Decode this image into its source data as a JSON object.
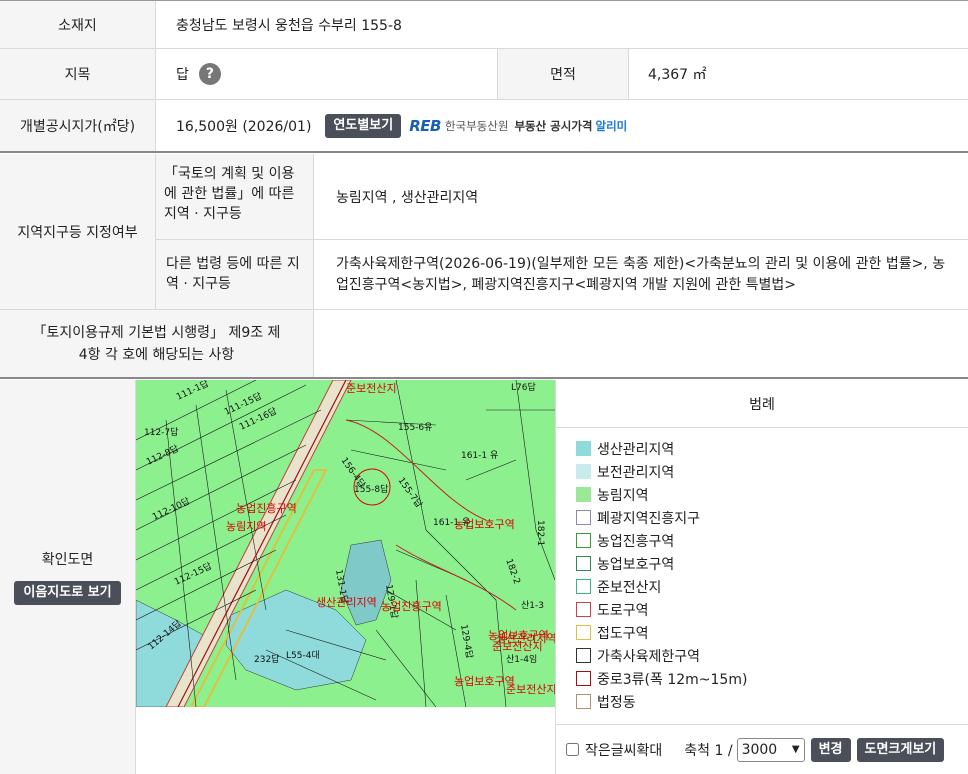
{
  "location": {
    "label": "소재지",
    "value": "충청남도 보령시 웅천읍 수부리 155-8"
  },
  "jimok": {
    "label": "지목",
    "value": "답",
    "help": "?"
  },
  "area": {
    "label": "면적",
    "value": "4,367 ㎡"
  },
  "price": {
    "label": "개별공시지가(㎡당)",
    "value": "16,500원 (2026/01)",
    "yearly_button": "연도별보기",
    "reb_logo": "REB",
    "reb_org": "한국부동산원",
    "reb_service": "부동산 공시가격",
    "reb_highlight": "알리미"
  },
  "zoning": {
    "label": "지역지구등 지정여부",
    "sub1_label": "「국토의 계획 및 이용에 관한 법률」에 따른 지역 · 지구등",
    "sub1_value": "농림지역 , 생산관리지역",
    "sub2_label": "다른 법령 등에 따른 지역 · 지구등",
    "sub2_value": "가축사육제한구역(2026-06-19)(일부제한 모든 축종 제한)<가축분뇨의 관리 및 이용에 관한 법률>, 농업진흥구역<농지법>, 폐광지역진흥지구<폐광지역 개발 지원에 관한 특별법>"
  },
  "regulation": {
    "label": "「토지이용규제 기본법 시행령」 제9조 제4항 각 호에 해당되는 사항",
    "value": ""
  },
  "map": {
    "label": "확인도면",
    "view_button": "이음지도로 보기",
    "labels": [
      "준보전산지",
      "155-8답",
      "161-1 유",
      "161-1 유",
      "농업보호구역",
      "농업진흥구역",
      "농림지역",
      "생산관리지역",
      "농업진흥구역",
      "농업보호구역",
      "준보전산지",
      "생산관리지역",
      "농업보호구역",
      "준보전산지"
    ],
    "parcels": [
      "112-7답",
      "112-8답",
      "112-10답",
      "112-15답",
      "112-14답",
      "111-1답",
      "111-15답",
      "111-16답",
      "L76답",
      "155-6유",
      "156-4답",
      "155-7답",
      "산1-3",
      "L55-4대",
      "232답",
      "산1-4임",
      "129-1답",
      "129-4답",
      "182-1",
      "182-2",
      "131-1답"
    ]
  },
  "legend": {
    "title": "범례",
    "items": [
      {
        "label": "생산관리지역",
        "fill": "#8fdada",
        "border": "#8fdada"
      },
      {
        "label": "보전관리지역",
        "fill": "#c8ecee",
        "border": "#c8ecee"
      },
      {
        "label": "농림지역",
        "fill": "#9be89b",
        "border": "#9be89b"
      },
      {
        "label": "폐광지역진흥지구",
        "fill": "#ffffff",
        "border": "#8a8ab0"
      },
      {
        "label": "농업진흥구역",
        "fill": "#ffffff",
        "border": "#33a033"
      },
      {
        "label": "농업보호구역",
        "fill": "#ffffff",
        "border": "#2e8b57"
      },
      {
        "label": "준보전산지",
        "fill": "#ffffff",
        "border": "#3cb38b"
      },
      {
        "label": "도로구역",
        "fill": "#ffffff",
        "border": "#d04040"
      },
      {
        "label": "접도구역",
        "fill": "#ffffff",
        "border": "#e0c040"
      },
      {
        "label": "가축사육제한구역",
        "fill": "#ffffff",
        "border": "#333333"
      },
      {
        "label": "중로3류(폭 12m~15m)",
        "fill": "#ffffff",
        "border": "#a01010"
      },
      {
        "label": "법정동",
        "fill": "#ffffff",
        "border": "#b09070"
      }
    ]
  },
  "controls": {
    "small_text_label": "작은글씨확대",
    "scale_label": "축척 1 /",
    "scale_value": "3000",
    "change_button": "변경",
    "large_map_button": "도면크게보기"
  }
}
